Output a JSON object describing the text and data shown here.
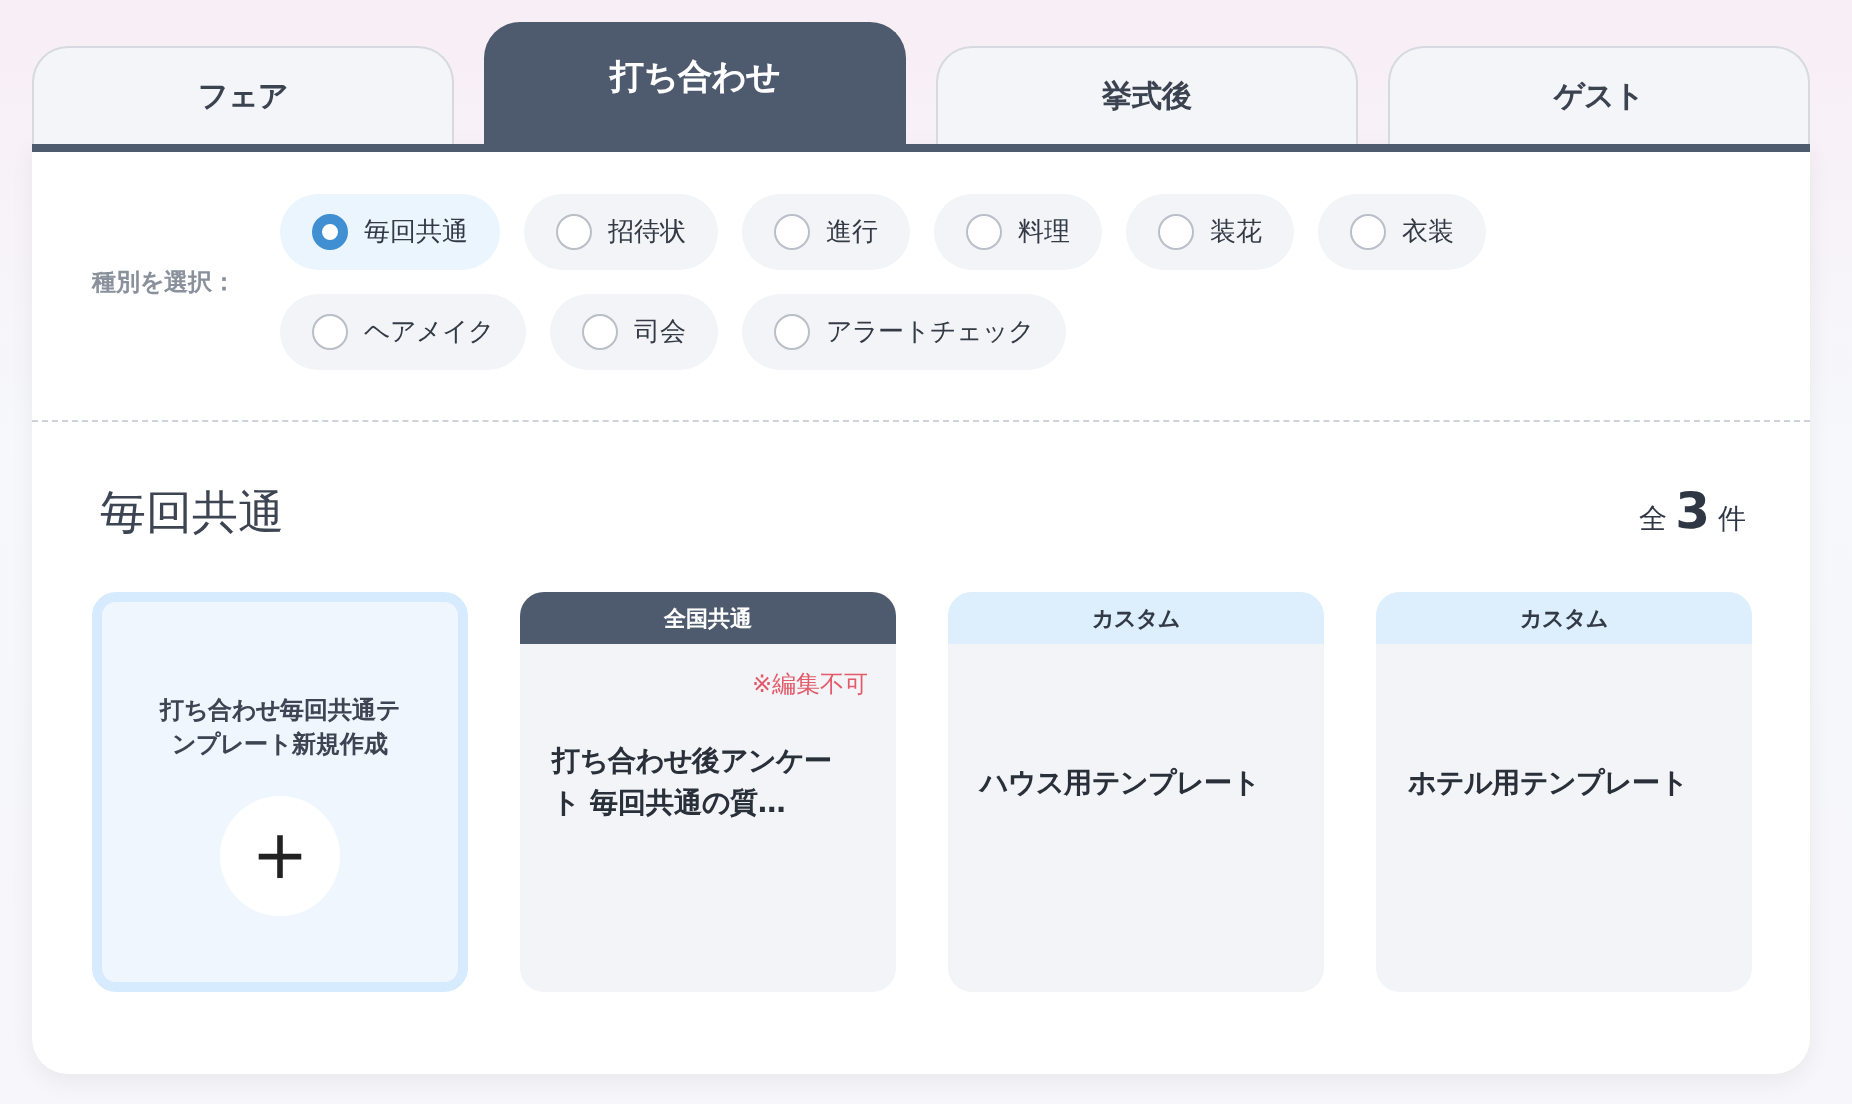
{
  "tabs": [
    {
      "label": "フェア",
      "selected": false
    },
    {
      "label": "打ち合わせ",
      "selected": true
    },
    {
      "label": "挙式後",
      "selected": false
    },
    {
      "label": "ゲスト",
      "selected": false
    }
  ],
  "filter": {
    "label": "種別を選択：",
    "options": [
      {
        "label": "毎回共通",
        "selected": true
      },
      {
        "label": "招待状",
        "selected": false
      },
      {
        "label": "進行",
        "selected": false
      },
      {
        "label": "料理",
        "selected": false
      },
      {
        "label": "装花",
        "selected": false
      },
      {
        "label": "衣装",
        "selected": false
      },
      {
        "label": "ヘアメイク",
        "selected": false
      },
      {
        "label": "司会",
        "selected": false
      },
      {
        "label": "アラートチェック",
        "selected": false
      }
    ]
  },
  "section": {
    "title": "毎回共通",
    "count_prefix": "全",
    "count": "3",
    "count_suffix": "件"
  },
  "cards": [
    {
      "kind": "create",
      "title": "打ち合わせ毎回共通テンプレート新規作成",
      "button": "+"
    },
    {
      "kind": "template",
      "badge": {
        "label": "全国共通",
        "color": "#4e5a6e"
      },
      "note": "※編集不可",
      "title": "打ち合わせ後アンケート 毎回共通の質…"
    },
    {
      "kind": "template",
      "badge": {
        "label": "カスタム",
        "color": "#ddeffd"
      },
      "title": "ハウス用テンプレート"
    },
    {
      "kind": "template",
      "badge": {
        "label": "カスタム",
        "color": "#ddeffd"
      },
      "title": "ホテル用テンプレート"
    }
  ]
}
